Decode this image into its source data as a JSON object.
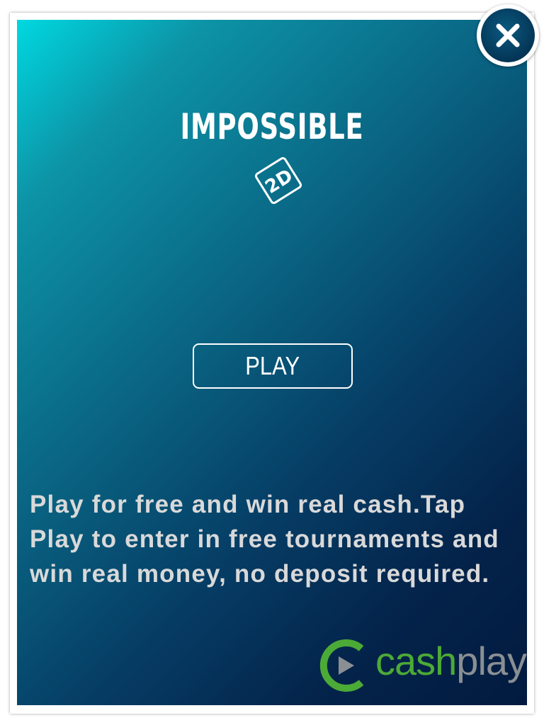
{
  "logo": {
    "title": "IMPOSSIBLE",
    "badge": "2D"
  },
  "play_button": {
    "label": "PLAY"
  },
  "promo": {
    "lines": [
      "Play for free and win real cash.Tap",
      "Play to enter in free tournaments and",
      "win real money, no deposit required."
    ]
  },
  "brand": {
    "cash": "cash",
    "play": "play",
    "icon": "play-icon"
  },
  "close": {
    "icon": "close-icon"
  },
  "colors": {
    "accent_green": "#4caa36",
    "brand_gray": "#8a8f93",
    "panel_top": "#00d8e0",
    "panel_bottom": "#021a3f"
  }
}
